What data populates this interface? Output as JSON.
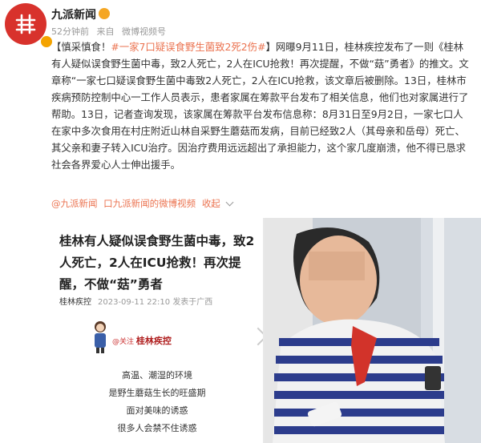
{
  "account": {
    "name": "九派新闻",
    "meta_time": "52分钟前",
    "meta_from": "来自",
    "meta_source": "微博视频号"
  },
  "post": {
    "prefix": "【慎采慎食！",
    "hashtag": "#一家7口疑误食野生菌致2死2伤#",
    "line1_rest": "】网曝9月11日，桂林疾控发布了一则",
    "body": "《桂林有人疑似误食野生菌中毒，致2人死亡，2人在ICU抢救！再次提醒，不做“菇”勇者》的推文。文章称“一家七口疑误食野生菌中毒致2人死亡，2人在ICU抢救，该文章后被删除。13日，桂林市疾病预防控制中心一工作人员表示，患者家属在筹款平台发布了相关信息，他们也对家属进行了帮助。13日，记者查询发现，该家属在筹款平台发布信息称：8月31日至9月2日，一家七口人在家中多次食用在村庄附近山林自采野生蘑菇而发病，目前已经致2人（其母亲和岳母）死亡、其父亲和妻子转入ICU治疗。因治疗费用远远超出了承担能力，这个家几度崩溃，他不得已恳求社会各界爱心人士伸出援手。"
  },
  "footer": {
    "mention": "@九派新闻",
    "video_link": "口九派新闻的微博视频",
    "collapse": "收起"
  },
  "card": {
    "title": "桂林有人疑似误食野生菌中毒，致2人死亡，2人在ICU抢救！再次提醒，不做“菇”勇者",
    "source": "桂林疾控",
    "date": "2023-09-11 22:10",
    "location": "发表于广西",
    "mascot_prefix": "@关注",
    "mascot_name": "桂林疾控",
    "lines": [
      "高温、潮湿的环境",
      "是野生蘑菇生长的旺盛期",
      "面对美味的诱惑",
      "很多人会禁不住诱惑"
    ]
  },
  "colors": {
    "accent": "#eb7350",
    "logo_red": "#d8322c"
  }
}
